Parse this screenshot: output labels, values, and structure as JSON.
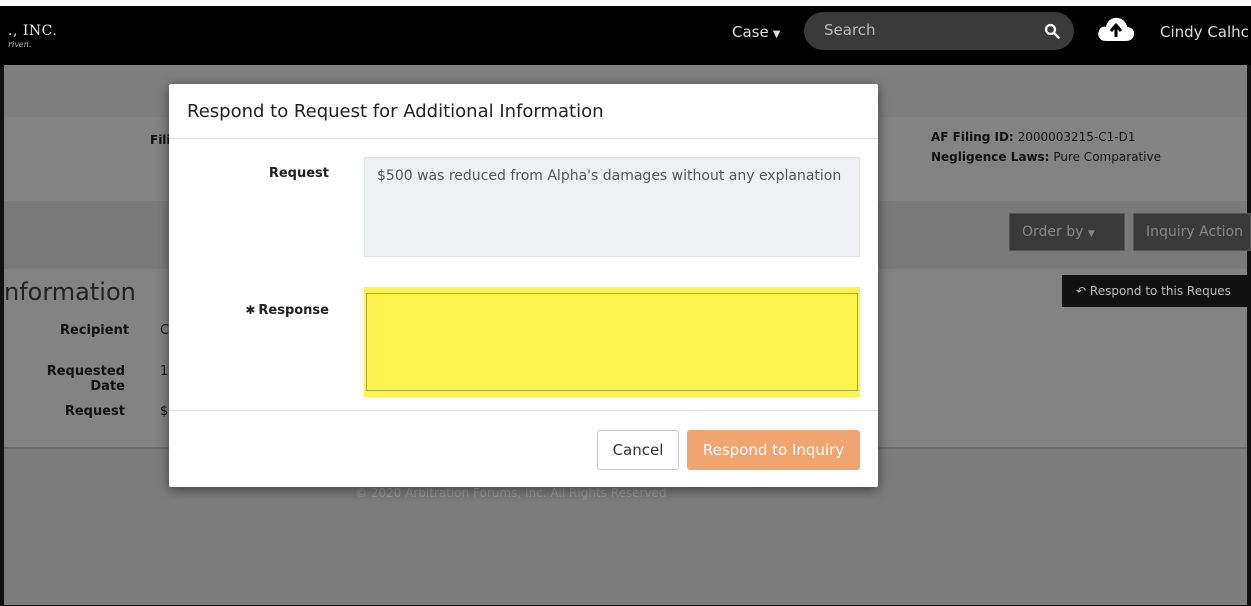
{
  "navbar": {
    "brand_line1": "., INC.",
    "brand_line2": "riven.",
    "case_menu": "Case",
    "search_placeholder": "Search",
    "user_name": "Cindy Calhc"
  },
  "filing": {
    "left_label": "Fili",
    "af_filing_label": "AF Filing ID:",
    "af_filing_value": "2000003215-C1-D1",
    "negligence_label": "Negligence Laws:",
    "negligence_value": "Pure Comparative"
  },
  "toolbar": {
    "order_by": "Order by",
    "inquiry_actions": "Inquiry Action"
  },
  "section": {
    "title": "nformation",
    "respond_button": "Respond to this Reques",
    "recipient_label": "Recipient",
    "recipient_value": "C",
    "requested_date_label": "Requested Date",
    "requested_date_value": "1",
    "request_label": "Request",
    "request_value": "$"
  },
  "footer": {
    "copyright": "© 2020 Arbitration Forums, Inc. All Rights Reserved"
  },
  "modal": {
    "title": "Respond to Request for Additional Information",
    "request_label": "Request",
    "request_text": "$500 was reduced from Alpha's damages without any explanation",
    "response_label": "Response",
    "response_value": "",
    "cancel_label": "Cancel",
    "respond_label": "Respond to Inquiry"
  },
  "colors": {
    "navbar_bg": "#000000",
    "highlight": "#fff44f",
    "primary_button": "#f0a470"
  }
}
